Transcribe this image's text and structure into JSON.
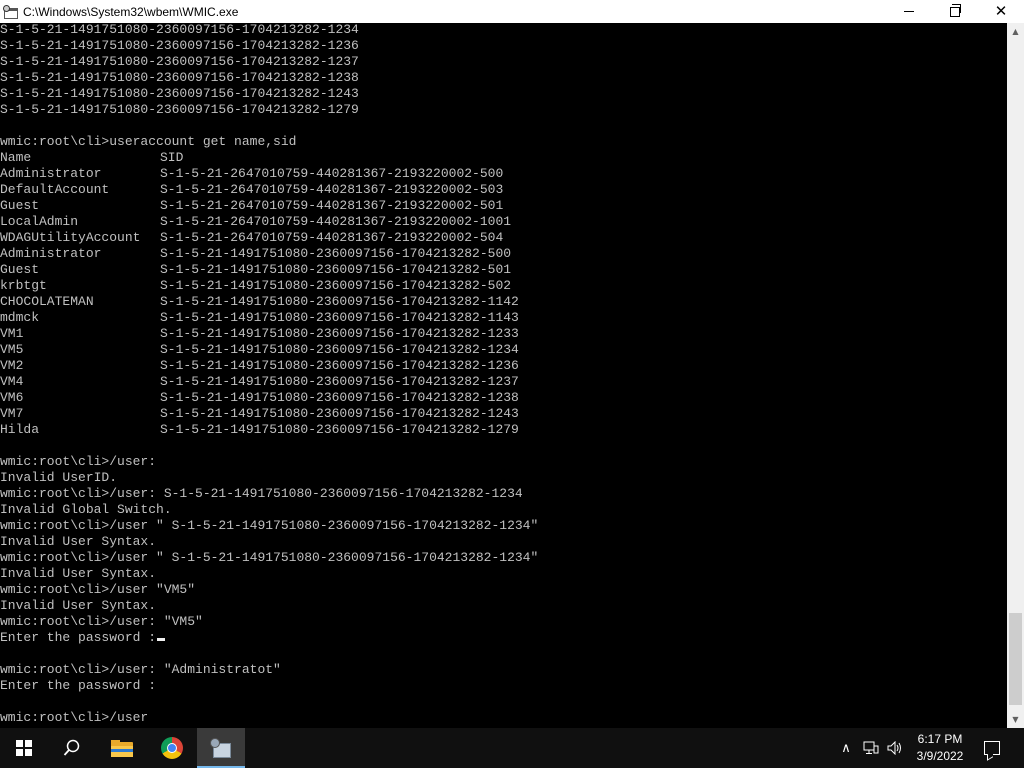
{
  "window": {
    "title": "C:\\Windows\\System32\\wbem\\WMIC.exe",
    "icon": "wmic-app-icon",
    "controls": {
      "minimize": "minimize-icon",
      "maximize": "maximize-icon",
      "close": "✕"
    }
  },
  "console": {
    "text_color": "#c0c0c0",
    "background": "#000000",
    "lines": [
      {
        "a": "S-1-5-21-1491751080-2360097156-1704213282-1234",
        "b": ""
      },
      {
        "a": "S-1-5-21-1491751080-2360097156-1704213282-1236",
        "b": ""
      },
      {
        "a": "S-1-5-21-1491751080-2360097156-1704213282-1237",
        "b": ""
      },
      {
        "a": "S-1-5-21-1491751080-2360097156-1704213282-1238",
        "b": ""
      },
      {
        "a": "S-1-5-21-1491751080-2360097156-1704213282-1243",
        "b": ""
      },
      {
        "a": "S-1-5-21-1491751080-2360097156-1704213282-1279",
        "b": ""
      },
      {
        "a": "",
        "b": ""
      },
      {
        "a": "wmic:root\\cli>useraccount get name,sid",
        "b": ""
      },
      {
        "a": "Name",
        "b": "SID"
      },
      {
        "a": "Administrator",
        "b": "S-1-5-21-2647010759-440281367-2193220002-500"
      },
      {
        "a": "DefaultAccount",
        "b": "S-1-5-21-2647010759-440281367-2193220002-503"
      },
      {
        "a": "Guest",
        "b": "S-1-5-21-2647010759-440281367-2193220002-501"
      },
      {
        "a": "LocalAdmin",
        "b": "S-1-5-21-2647010759-440281367-2193220002-1001"
      },
      {
        "a": "WDAGUtilityAccount",
        "b": "S-1-5-21-2647010759-440281367-2193220002-504"
      },
      {
        "a": "Administrator",
        "b": "S-1-5-21-1491751080-2360097156-1704213282-500"
      },
      {
        "a": "Guest",
        "b": "S-1-5-21-1491751080-2360097156-1704213282-501"
      },
      {
        "a": "krbtgt",
        "b": "S-1-5-21-1491751080-2360097156-1704213282-502"
      },
      {
        "a": "CHOCOLATEMAN",
        "b": "S-1-5-21-1491751080-2360097156-1704213282-1142"
      },
      {
        "a": "mdmck",
        "b": "S-1-5-21-1491751080-2360097156-1704213282-1143"
      },
      {
        "a": "VM1",
        "b": "S-1-5-21-1491751080-2360097156-1704213282-1233"
      },
      {
        "a": "VM5",
        "b": "S-1-5-21-1491751080-2360097156-1704213282-1234"
      },
      {
        "a": "VM2",
        "b": "S-1-5-21-1491751080-2360097156-1704213282-1236"
      },
      {
        "a": "VM4",
        "b": "S-1-5-21-1491751080-2360097156-1704213282-1237"
      },
      {
        "a": "VM6",
        "b": "S-1-5-21-1491751080-2360097156-1704213282-1238"
      },
      {
        "a": "VM7",
        "b": "S-1-5-21-1491751080-2360097156-1704213282-1243"
      },
      {
        "a": "Hilda",
        "b": "S-1-5-21-1491751080-2360097156-1704213282-1279"
      },
      {
        "a": "",
        "b": ""
      },
      {
        "a": "wmic:root\\cli>/user:",
        "b": ""
      },
      {
        "a": "Invalid UserID.",
        "b": ""
      },
      {
        "a": "wmic:root\\cli>/user: S-1-5-21-1491751080-2360097156-1704213282-1234",
        "b": ""
      },
      {
        "a": "Invalid Global Switch.",
        "b": ""
      },
      {
        "a": "wmic:root\\cli>/user \" S-1-5-21-1491751080-2360097156-1704213282-1234\"",
        "b": ""
      },
      {
        "a": "Invalid User Syntax.",
        "b": ""
      },
      {
        "a": "wmic:root\\cli>/user \" S-1-5-21-1491751080-2360097156-1704213282-1234\"",
        "b": ""
      },
      {
        "a": "Invalid User Syntax.",
        "b": ""
      },
      {
        "a": "wmic:root\\cli>/user \"VM5\"",
        "b": ""
      },
      {
        "a": "Invalid User Syntax.",
        "b": ""
      },
      {
        "a": "wmic:root\\cli>/user: \"VM5\"",
        "b": ""
      },
      {
        "a": "Enter the password :",
        "b": "",
        "cursor": true
      },
      {
        "a": "",
        "b": ""
      },
      {
        "a": "wmic:root\\cli>/user: \"Administratot\"",
        "b": ""
      },
      {
        "a": "Enter the password :",
        "b": ""
      },
      {
        "a": "",
        "b": ""
      },
      {
        "a": "wmic:root\\cli>/user",
        "b": ""
      }
    ]
  },
  "scrollbar": {
    "position_fraction": 0.93,
    "up_icon": "▲",
    "down_icon": "▼"
  },
  "taskbar": {
    "background": "#101010",
    "pinned": [
      {
        "name": "start-button",
        "icon": "windows-logo-icon"
      },
      {
        "name": "search-button",
        "icon": "search-icon"
      },
      {
        "name": "file-explorer",
        "icon": "folder-icon"
      },
      {
        "name": "google-chrome",
        "icon": "chrome-icon"
      },
      {
        "name": "wmic-window",
        "icon": "wmic-app-icon",
        "active": true
      }
    ],
    "tray": {
      "chevron": "∧",
      "network_icon": "network-icon",
      "volume_icon": "volume-icon",
      "time": "6:17 PM",
      "date": "3/9/2022",
      "notification_icon": "notification-icon"
    }
  }
}
